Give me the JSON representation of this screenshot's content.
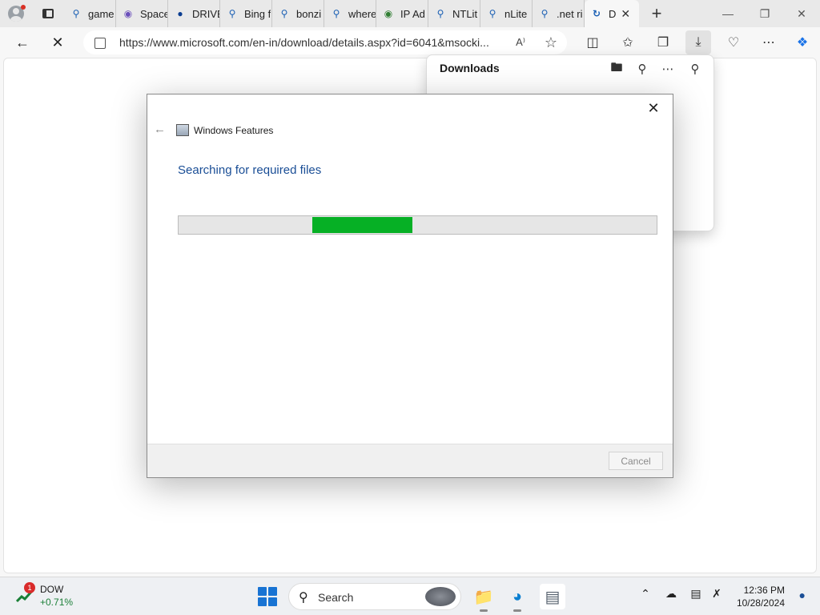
{
  "browser": {
    "tabs": [
      {
        "label": "game",
        "icon": "search-icon"
      },
      {
        "label": "Space",
        "icon": "space-icon"
      },
      {
        "label": "DRIVE",
        "icon": "drive-icon"
      },
      {
        "label": "Bing f",
        "icon": "search-icon"
      },
      {
        "label": "bonzi",
        "icon": "search-icon"
      },
      {
        "label": "where",
        "icon": "search-icon"
      },
      {
        "label": "IP Ad",
        "icon": "globe-icon"
      },
      {
        "label": "NTLit",
        "icon": "search-icon"
      },
      {
        "label": "nLite",
        "icon": "search-icon"
      },
      {
        "label": ".net ri",
        "icon": "search-icon"
      },
      {
        "label": "D",
        "icon": "loading-icon"
      }
    ],
    "address": "https://www.microsoft.com/en-in/download/details.aspx?id=6041&msocki...",
    "read_aloud": "A⁾"
  },
  "downloads": {
    "title": "Downloads"
  },
  "dialog": {
    "window_title": "Windows Features",
    "heading": "Searching for required files",
    "progress_start": 0.28,
    "progress_end": 0.49,
    "progress_color": "#06b025",
    "cancel_label": "Cancel"
  },
  "taskbar": {
    "widget_badge": "1",
    "widget_name": "DOW",
    "widget_change": "+0.71%",
    "search_placeholder": "Search",
    "time": "12:36 PM",
    "date": "10/28/2024"
  },
  "colors": {
    "accent_blue": "#1a4e96",
    "progress_green": "#06b025",
    "start_blue": "#1873d3"
  }
}
